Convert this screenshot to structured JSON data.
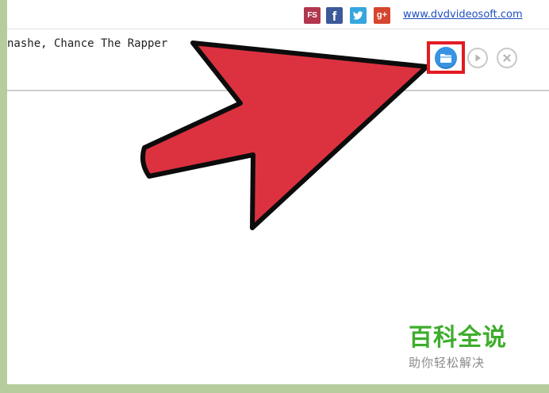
{
  "header": {
    "social_icons": [
      {
        "name": "fs-icon",
        "label": "FS"
      },
      {
        "name": "facebook-icon",
        "label": "f"
      },
      {
        "name": "twitter-icon",
        "label": ""
      },
      {
        "name": "google-plus-icon",
        "label": "g+"
      }
    ],
    "site_link": "www.dvdvideosoft.com"
  },
  "track": {
    "title": "nashe, Chance The Rapper"
  },
  "controls": {
    "open_folder_icon": "folder-icon",
    "play_icon": "play-icon",
    "remove_icon": "close-icon"
  },
  "watermark": {
    "title": "百科全说",
    "subtitle": "助你轻松解决"
  },
  "colors": {
    "accent_arrow": "#dc3240",
    "highlight_box": "#e21b23",
    "folder_button": "#3794e4",
    "page_border": "#b7cc9c",
    "watermark_green": "#3ead2c"
  }
}
